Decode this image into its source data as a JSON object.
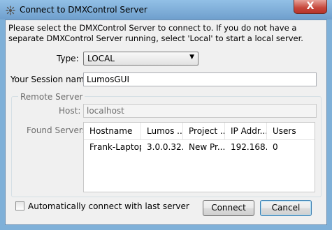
{
  "window": {
    "title": "Connect to DMXControl Server",
    "close_label": "X"
  },
  "description": "Please select the DMXControl Server to connect to. If you do not have a separate DMXControl Server running, select 'Local' to start a local server.",
  "type": {
    "label": "Type:",
    "value": "LOCAL"
  },
  "session": {
    "label": "Your Session name:",
    "value": "LumosGUI"
  },
  "remote_server": {
    "group_label": "Remote Server",
    "host_label": "Host:",
    "host_value": "localhost",
    "found_label": "Found Servers:"
  },
  "servers_table": {
    "columns": [
      "Hostname",
      "Lumos ...",
      "Project ...",
      "IP Addr...",
      "Users"
    ],
    "rows": [
      [
        "Frank-Laptop",
        "3.0.0.32...",
        "New Pr...",
        "192.168....",
        "0"
      ]
    ]
  },
  "auto_connect": {
    "label": "Automatically connect with last server",
    "checked": false
  },
  "buttons": {
    "connect": "Connect",
    "cancel": "Cancel"
  }
}
